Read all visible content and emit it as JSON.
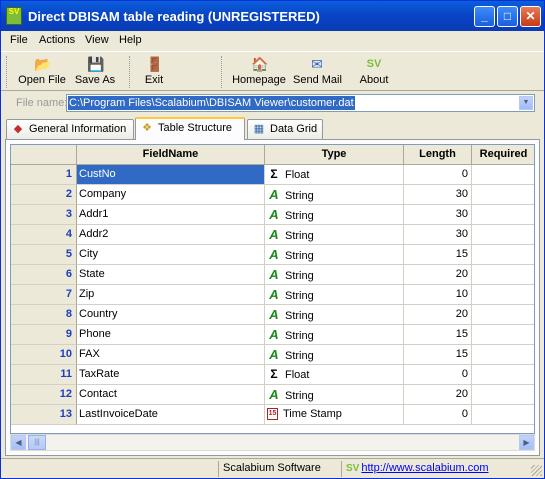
{
  "window": {
    "title": "Direct DBISAM table reading (UNREGISTERED)",
    "app_icon_text": "SV",
    "minimize_glyph": "_",
    "maximize_glyph": "□",
    "close_glyph": "✕"
  },
  "menu": {
    "file": "File",
    "actions": "Actions",
    "view": "View",
    "help": "Help"
  },
  "toolbar": {
    "open_file": "Open File",
    "save_as": "Save As",
    "exit": "Exit",
    "homepage": "Homepage",
    "send_mail": "Send Mail",
    "about": "About"
  },
  "file_name": {
    "label": "File name:",
    "value": "C:\\Program Files\\Scalabium\\DBISAM Viewer\\customer.dat"
  },
  "tabs": {
    "general": "General Information",
    "structure": "Table Structure",
    "grid": "Data Grid"
  },
  "grid": {
    "columns": [
      "FieldName",
      "Type",
      "Length",
      "Required"
    ],
    "rows": [
      {
        "num": "1",
        "name": "CustNo",
        "type": "Float",
        "length": "0"
      },
      {
        "num": "2",
        "name": "Company",
        "type": "String",
        "length": "30"
      },
      {
        "num": "3",
        "name": "Addr1",
        "type": "String",
        "length": "30"
      },
      {
        "num": "4",
        "name": "Addr2",
        "type": "String",
        "length": "30"
      },
      {
        "num": "5",
        "name": "City",
        "type": "String",
        "length": "15"
      },
      {
        "num": "6",
        "name": "State",
        "type": "String",
        "length": "20"
      },
      {
        "num": "7",
        "name": "Zip",
        "type": "String",
        "length": "10"
      },
      {
        "num": "8",
        "name": "Country",
        "type": "String",
        "length": "20"
      },
      {
        "num": "9",
        "name": "Phone",
        "type": "String",
        "length": "15"
      },
      {
        "num": "10",
        "name": "FAX",
        "type": "String",
        "length": "15"
      },
      {
        "num": "11",
        "name": "TaxRate",
        "type": "Float",
        "length": "0"
      },
      {
        "num": "12",
        "name": "Contact",
        "type": "String",
        "length": "20"
      },
      {
        "num": "13",
        "name": "LastInvoiceDate",
        "type": "Time Stamp",
        "length": "0"
      }
    ],
    "type_icons": {
      "Float": "Σ",
      "String": "A",
      "Time Stamp": "15"
    }
  },
  "status": {
    "company": "Scalabium Software",
    "url": "http://www.scalabium.com"
  },
  "colors": {
    "title_bar": "#0a5fdc",
    "selection": "#316ac5",
    "row_number": "#1c3fc0",
    "string_icon": "#1a8a1a"
  }
}
